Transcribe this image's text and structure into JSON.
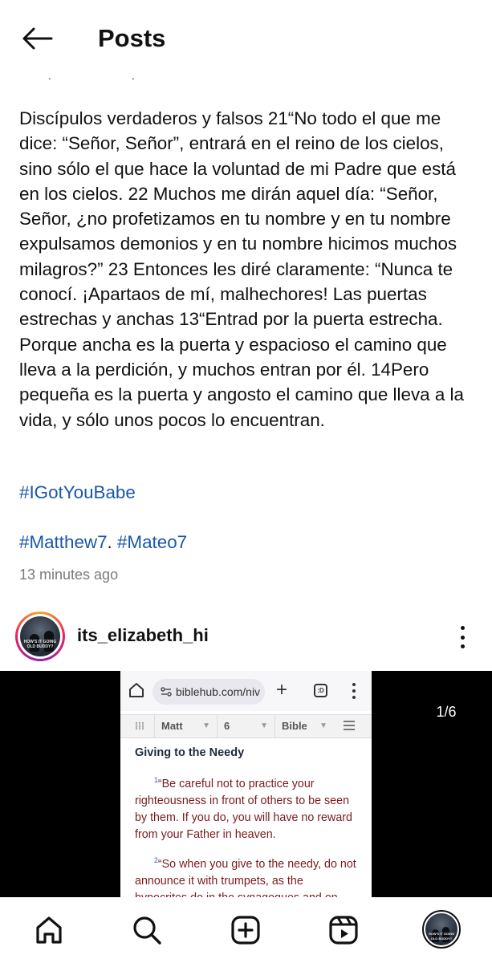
{
  "header": {
    "title": "Posts",
    "back_icon": "arrow-left-icon"
  },
  "post": {
    "caption": " Discípulos verdaderos y falsos 21“No todo el que me dice: “Señor, Señor”, entrará en el reino de los cielos, sino sólo el que hace la voluntad de mi Padre que está en los cielos. 22 Muchos me dirán aquel día: “Señor, Señor, ¿no profetizamos en tu nombre y en tu nombre expulsamos demonios y en tu nombre hicimos muchos milagros?” 23 Entonces les diré claramente: “Nunca te conocí. ¡Apartaos de mí, malhechores! Las puertas estrechas y anchas 13“Entrad por la puerta estrecha. Porque ancha es la puerta y espacioso el camino que lleva a la perdición, y muchos entran por él. 14Pero pequeña es la puerta y angosto el camino que lleva a la vida, y sólo unos pocos lo encuentran.",
    "hashtag_1": "#IGotYouBabe",
    "hashtag_2a": "#Matthew7",
    "hashtag_sep": ". ",
    "hashtag_2b": "#Mateo7",
    "timestamp": "13 minutes ago"
  },
  "next_post": {
    "username": "its_elizabeth_hi",
    "avatar_text": "HOW'S IT GOING OLD BUDDY?",
    "media_counter": "1/6",
    "browser": {
      "url": "biblehub.com/niv",
      "tabs_label": ":D",
      "book": "Matt",
      "chapter": "6",
      "version": "Bible"
    },
    "heading": "Giving to the Needy",
    "verses": [
      {
        "num": "1",
        "text": "“Be careful not to practice your righteousness in front of others to be seen by them. If you do, you will have no reward from your Father in heaven."
      },
      {
        "num": "2",
        "text": "“So when you give to the needy, do not announce it with trumpets, as the hypocrites do in the synagogues and on"
      }
    ]
  },
  "colors": {
    "hashtag": "#1a57a8",
    "verse_text": "#7b1a1a",
    "verse_number": "#2a6bb5"
  },
  "bottom_nav": {
    "items": [
      "home-icon",
      "search-icon",
      "create-post-icon",
      "reels-icon",
      "profile-avatar"
    ]
  }
}
